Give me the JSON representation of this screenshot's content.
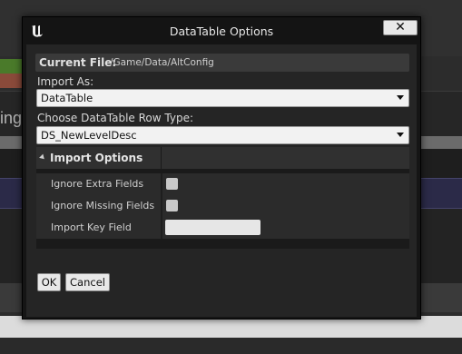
{
  "background": {
    "fragment_text": "ing"
  },
  "dialog": {
    "title": "DataTable Options",
    "close_glyph": "✕",
    "logo_icon": "unreal-engine-logo",
    "current_file": {
      "label": "Current File:",
      "path": "/Game/Data/AltConfig"
    },
    "import_as": {
      "label": "Import As:",
      "value": "DataTable"
    },
    "row_type": {
      "label": "Choose DataTable Row Type:",
      "value": "DS_NewLevelDesc"
    },
    "import_options": {
      "title": "Import Options",
      "fields": [
        {
          "label": "Ignore Extra Fields",
          "kind": "checkbox",
          "checked": false
        },
        {
          "label": "Ignore Missing Fields",
          "kind": "checkbox",
          "checked": false
        },
        {
          "label": "Import Key Field",
          "kind": "text",
          "value": ""
        }
      ]
    },
    "buttons": {
      "ok": "OK",
      "cancel": "Cancel"
    }
  }
}
